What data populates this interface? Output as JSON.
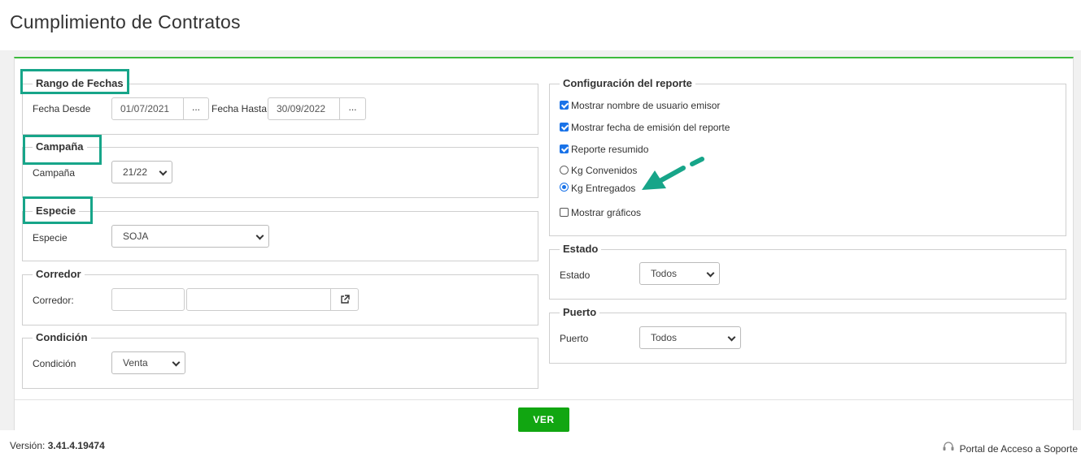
{
  "page": {
    "title": "Cumplimiento de Contratos"
  },
  "rango_fechas": {
    "legend": "Rango de Fechas",
    "desde_label": "Fecha Desde",
    "desde_value": "01/07/2021",
    "hasta_label": "Fecha Hasta",
    "hasta_value": "30/09/2022",
    "picker_label": "..."
  },
  "campana": {
    "legend": "Campaña",
    "label": "Campaña",
    "value": "21/22"
  },
  "especie": {
    "legend": "Especie",
    "label": "Especie",
    "value": "SOJA"
  },
  "corredor": {
    "legend": "Corredor",
    "label": "Corredor:",
    "code_value": "",
    "name_value": "",
    "lookup_icon": "external-link-icon"
  },
  "condicion": {
    "legend": "Condición",
    "label": "Condición",
    "value": "Venta"
  },
  "configuracion": {
    "legend": "Configuración del reporte",
    "options": [
      {
        "type": "checkbox",
        "label": "Mostrar nombre de usuario emisor",
        "checked": true
      },
      {
        "type": "checkbox",
        "label": "Mostrar fecha de emisión del reporte",
        "checked": true
      },
      {
        "type": "checkbox",
        "label": "Reporte resumido",
        "checked": true
      },
      {
        "type": "radio",
        "label": "Kg Convenidos",
        "checked": false
      },
      {
        "type": "radio",
        "label": "Kg Entregados",
        "checked": true
      },
      {
        "type": "checkbox",
        "label": "Mostrar gráficos",
        "checked": false
      }
    ]
  },
  "estado": {
    "legend": "Estado",
    "label": "Estado",
    "value": "Todos"
  },
  "puerto": {
    "legend": "Puerto",
    "label": "Puerto",
    "value": "Todos"
  },
  "actions": {
    "ver_label": "VER"
  },
  "footer": {
    "version_prefix": "Versión:",
    "version_value": "3.41.4.19474",
    "support_label": "Portal de Acceso a Soporte"
  },
  "colors": {
    "accent_green": "#3dbb3d",
    "button_green": "#11a611",
    "annotation_teal": "#17a589",
    "check_blue": "#1a73e8"
  }
}
